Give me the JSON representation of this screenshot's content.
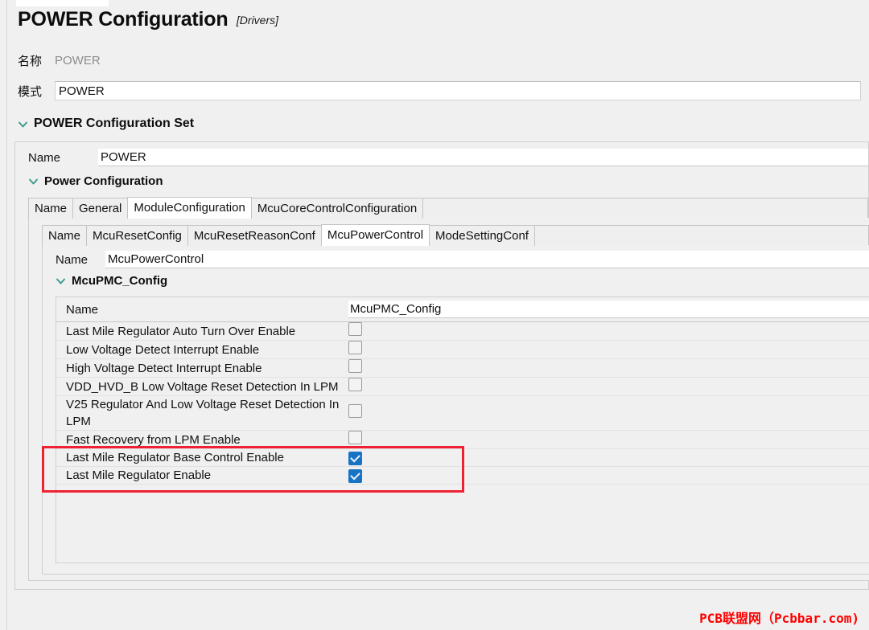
{
  "window": {
    "active_editor_tab": ""
  },
  "header": {
    "title": "POWER Configuration",
    "subtitle": "[Drivers]"
  },
  "top_fields": [
    {
      "label": "名称",
      "value": "POWER",
      "readonly": true
    },
    {
      "label": "模式",
      "value": "POWER",
      "readonly": false
    }
  ],
  "section_power_config_set": {
    "title": "POWER Configuration Set",
    "chevron_icon": "chevron-down-icon",
    "name_label": "Name",
    "name_value": "POWER"
  },
  "section_power_configuration": {
    "title": "Power Configuration",
    "chevron_icon": "chevron-down-icon",
    "tabs": [
      {
        "label": "Name",
        "active": false
      },
      {
        "label": "General",
        "active": false
      },
      {
        "label": "ModuleConfiguration",
        "active": true
      },
      {
        "label": "McuCoreControlConfiguration",
        "active": false
      }
    ]
  },
  "module_configuration": {
    "tabs": [
      {
        "label": "Name",
        "active": false
      },
      {
        "label": "McuResetConfig",
        "active": false
      },
      {
        "label": "McuResetReasonConf",
        "active": false
      },
      {
        "label": "McuPowerControl",
        "active": true
      },
      {
        "label": "ModeSettingConf",
        "active": false
      }
    ],
    "name_label": "Name",
    "name_value": "McuPowerControl"
  },
  "section_mcupmc_config": {
    "title": "McuPMC_Config",
    "chevron_icon": "chevron-down-icon",
    "header_key": "Name",
    "header_value": "McuPMC_Config",
    "rows": [
      {
        "label": "Last Mile Regulator Auto Turn Over Enable",
        "checked": false,
        "highlighted": false
      },
      {
        "label": "Low Voltage Detect Interrupt Enable",
        "checked": false,
        "highlighted": false
      },
      {
        "label": "High Voltage Detect Interrupt Enable",
        "checked": false,
        "highlighted": false
      },
      {
        "label": "VDD_HVD_B Low Voltage Reset Detection In LPM",
        "checked": false,
        "highlighted": false
      },
      {
        "label": "V25 Regulator And Low Voltage Reset Detection In LPM",
        "checked": false,
        "highlighted": false
      },
      {
        "label": "Fast Recovery from LPM Enable",
        "checked": false,
        "highlighted": false
      },
      {
        "label": "Last Mile Regulator Base Control Enable",
        "checked": true,
        "highlighted": true
      },
      {
        "label": "Last Mile Regulator Enable",
        "checked": true,
        "highlighted": true
      }
    ]
  },
  "watermark": {
    "text": "PCB联盟网（Pcbbar.com)"
  },
  "colors": {
    "chevron": "#3c9e8a",
    "checkbox_checked": "#1873c4",
    "highlight_box": "#ee2233",
    "watermark": "#fe0000",
    "panel_bg": "#f0f0f0",
    "input_bg": "#ffffff"
  }
}
